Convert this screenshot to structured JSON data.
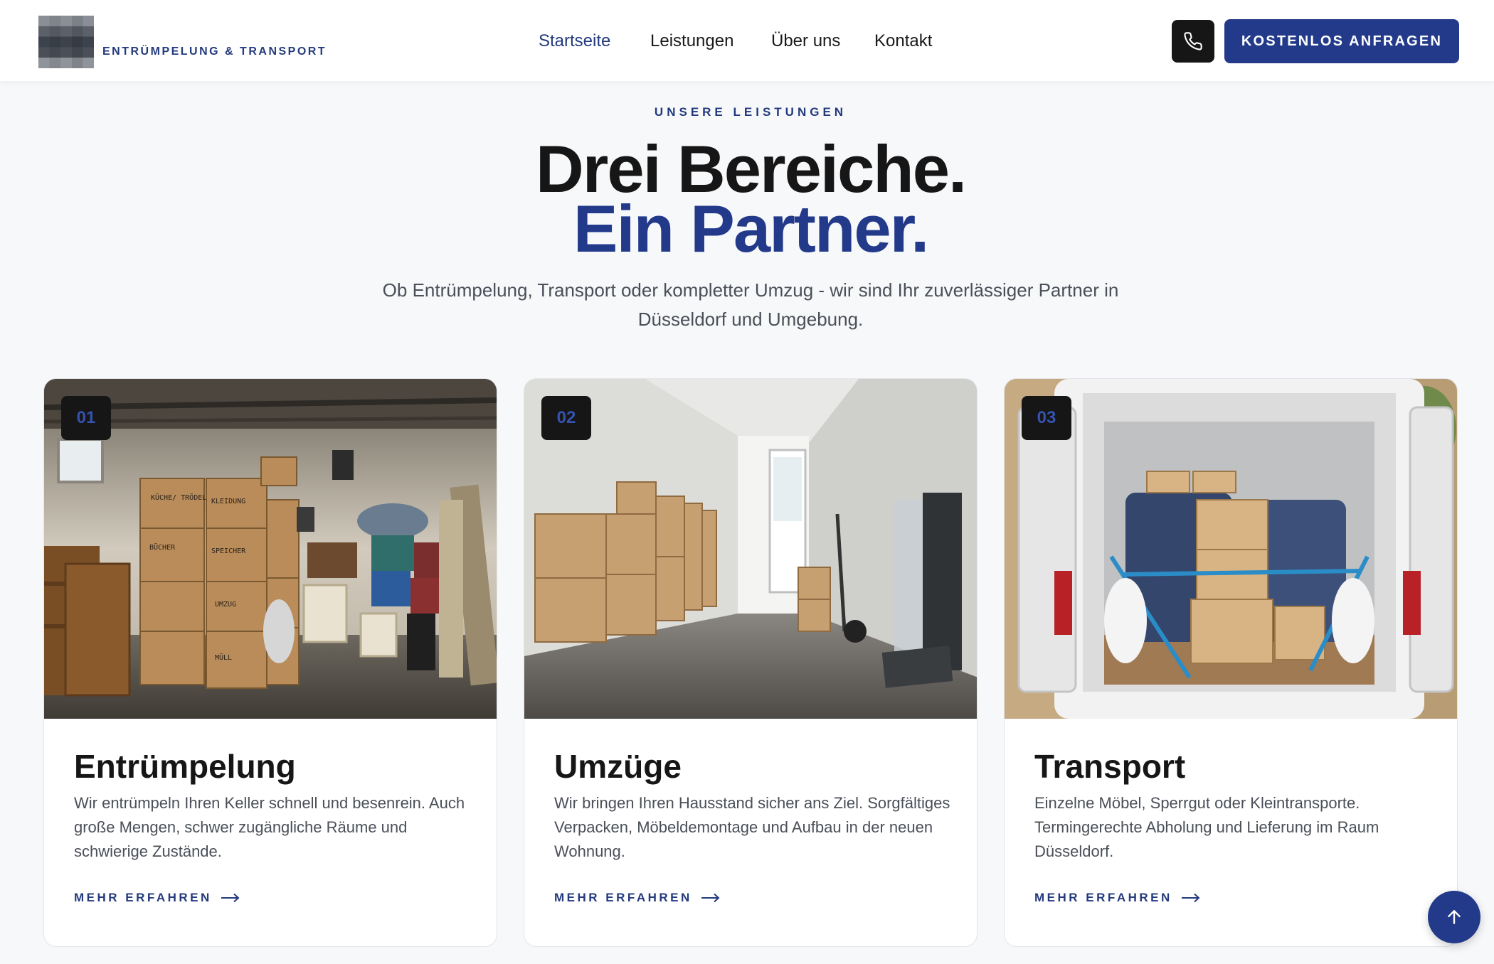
{
  "header": {
    "brand": "ENTRÜMPELUNG & TRANSPORT",
    "nav": [
      {
        "label": "Startseite"
      },
      {
        "label": "Leistungen"
      },
      {
        "label": "Über uns"
      },
      {
        "label": "Kontakt"
      }
    ],
    "cta_label": "KOSTENLOS ANFRAGEN",
    "phone_icon": "phone-icon"
  },
  "section": {
    "eyebrow": "UNSERE LEISTUNGEN",
    "title_line1": "Drei Bereiche.",
    "title_line2": "Ein Partner.",
    "lead": "Ob Entrümpelung, Transport oder kompletter Umzug - wir sind Ihr zuverlässiger Partner in Düsseldorf und Umgebung."
  },
  "cards": [
    {
      "number": "01",
      "title": "Entrümpelung",
      "text": "Wir entrümpeln Ihren Keller schnell und besenrein. Auch große Mengen, schwer zugängliche Räume und schwierige Zustände.",
      "link": "MEHR ERFAHREN",
      "box_labels": [
        "KÜCHE/ TRÖDEL",
        "KLEIDUNG",
        "BÜCHER",
        "SPEICHER",
        "UMZUG",
        "MÜLL"
      ]
    },
    {
      "number": "02",
      "title": "Umzüge",
      "text": "Wir bringen Ihren Hausstand sicher ans Ziel. Sorgfältiges Verpacken, Möbeldemontage und Aufbau in der neuen Wohnung.",
      "link": "MEHR ERFAHREN"
    },
    {
      "number": "03",
      "title": "Transport",
      "text": "Einzelne Möbel, Sperrgut oder Kleintransporte. Termingerechte Abholung und Lieferung im Raum Düsseldorf.",
      "link": "MEHR ERFAHREN"
    }
  ],
  "colors": {
    "accent": "#233a8b",
    "dark": "#161616",
    "background": "#f7f8fa"
  }
}
